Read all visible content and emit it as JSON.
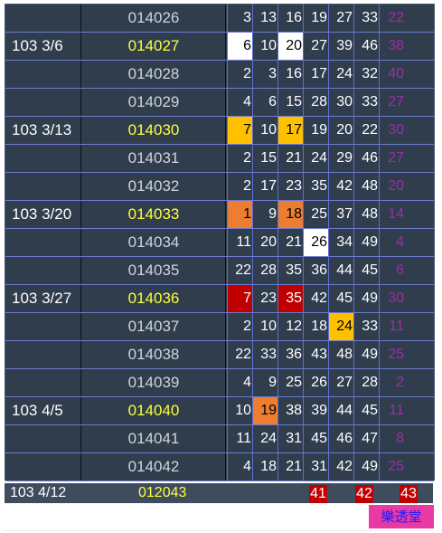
{
  "rows": [
    {
      "date": "",
      "issue": "014026",
      "hl": false,
      "nums": [
        "3",
        "13",
        "16",
        "19",
        "27",
        "33",
        "22"
      ],
      "styles": [
        "",
        "",
        "",
        "",
        "",
        "",
        ""
      ]
    },
    {
      "date": "103 3/6",
      "issue": "014027",
      "hl": true,
      "nums": [
        "6",
        "10",
        "20",
        "27",
        "39",
        "46",
        "38"
      ],
      "styles": [
        "w",
        "",
        "w",
        "",
        "",
        "",
        ""
      ]
    },
    {
      "date": "",
      "issue": "014028",
      "hl": false,
      "nums": [
        "2",
        "3",
        "16",
        "17",
        "24",
        "32",
        "40"
      ],
      "styles": [
        "",
        "",
        "",
        "",
        "",
        "",
        ""
      ]
    },
    {
      "date": "",
      "issue": "014029",
      "hl": false,
      "nums": [
        "4",
        "6",
        "15",
        "28",
        "30",
        "33",
        "27"
      ],
      "styles": [
        "",
        "",
        "",
        "",
        "",
        "",
        ""
      ]
    },
    {
      "date": "103 3/13",
      "issue": "014030",
      "hl": true,
      "nums": [
        "7",
        "10",
        "17",
        "19",
        "20",
        "22",
        "30"
      ],
      "styles": [
        "y",
        "",
        "y",
        "",
        "",
        "",
        ""
      ]
    },
    {
      "date": "",
      "issue": "014031",
      "hl": false,
      "nums": [
        "2",
        "15",
        "21",
        "24",
        "29",
        "46",
        "27"
      ],
      "styles": [
        "",
        "",
        "",
        "",
        "",
        "",
        ""
      ]
    },
    {
      "date": "",
      "issue": "014032",
      "hl": false,
      "nums": [
        "2",
        "17",
        "23",
        "35",
        "42",
        "48",
        "20"
      ],
      "styles": [
        "",
        "",
        "",
        "",
        "",
        "",
        ""
      ]
    },
    {
      "date": "103 3/20",
      "issue": "014033",
      "hl": true,
      "nums": [
        "1",
        "9",
        "18",
        "25",
        "37",
        "48",
        "14"
      ],
      "styles": [
        "o",
        "",
        "o",
        "",
        "",
        "",
        ""
      ]
    },
    {
      "date": "",
      "issue": "014034",
      "hl": false,
      "nums": [
        "11",
        "20",
        "21",
        "26",
        "34",
        "49",
        "4"
      ],
      "styles": [
        "",
        "",
        "",
        "w",
        "",
        "",
        ""
      ]
    },
    {
      "date": "",
      "issue": "014035",
      "hl": false,
      "nums": [
        "22",
        "28",
        "35",
        "36",
        "44",
        "45",
        "6"
      ],
      "styles": [
        "",
        "",
        "",
        "",
        "",
        "",
        ""
      ]
    },
    {
      "date": "103 3/27",
      "issue": "014036",
      "hl": true,
      "nums": [
        "7",
        "23",
        "35",
        "42",
        "45",
        "49",
        "30"
      ],
      "styles": [
        "r",
        "",
        "r",
        "",
        "",
        "",
        ""
      ]
    },
    {
      "date": "",
      "issue": "014037",
      "hl": false,
      "nums": [
        "2",
        "10",
        "12",
        "18",
        "24",
        "33",
        "11"
      ],
      "styles": [
        "",
        "",
        "",
        "",
        "y",
        "",
        ""
      ]
    },
    {
      "date": "",
      "issue": "014038",
      "hl": false,
      "nums": [
        "22",
        "33",
        "36",
        "43",
        "48",
        "49",
        "25"
      ],
      "styles": [
        "",
        "",
        "",
        "",
        "",
        "",
        ""
      ]
    },
    {
      "date": "",
      "issue": "014039",
      "hl": false,
      "nums": [
        "4",
        "9",
        "25",
        "26",
        "27",
        "28",
        "2"
      ],
      "styles": [
        "",
        "",
        "",
        "",
        "",
        "",
        ""
      ]
    },
    {
      "date": "103 4/5",
      "issue": "014040",
      "hl": true,
      "nums": [
        "10",
        "19",
        "38",
        "39",
        "44",
        "45",
        "11"
      ],
      "styles": [
        "",
        "o",
        "",
        "",
        "",
        "",
        ""
      ]
    },
    {
      "date": "",
      "issue": "014041",
      "hl": false,
      "nums": [
        "11",
        "24",
        "31",
        "45",
        "46",
        "47",
        "8"
      ],
      "styles": [
        "",
        "",
        "",
        "",
        "",
        "",
        ""
      ]
    },
    {
      "date": "",
      "issue": "014042",
      "hl": false,
      "nums": [
        "4",
        "18",
        "21",
        "31",
        "42",
        "49",
        "25"
      ],
      "styles": [
        "",
        "",
        "",
        "",
        "",
        "",
        ""
      ]
    }
  ],
  "summary": {
    "date": "103 4/12",
    "issue": "012043",
    "nums": [
      "41",
      "42",
      "43"
    ]
  },
  "logo": "樂透堂",
  "colors": {
    "white": "#ffffff",
    "yellow": "#ffc000",
    "orange": "#ed7d31",
    "red": "#c00000",
    "last_col": "#9b2fa6",
    "issue_highlight": "#ffff3a"
  }
}
